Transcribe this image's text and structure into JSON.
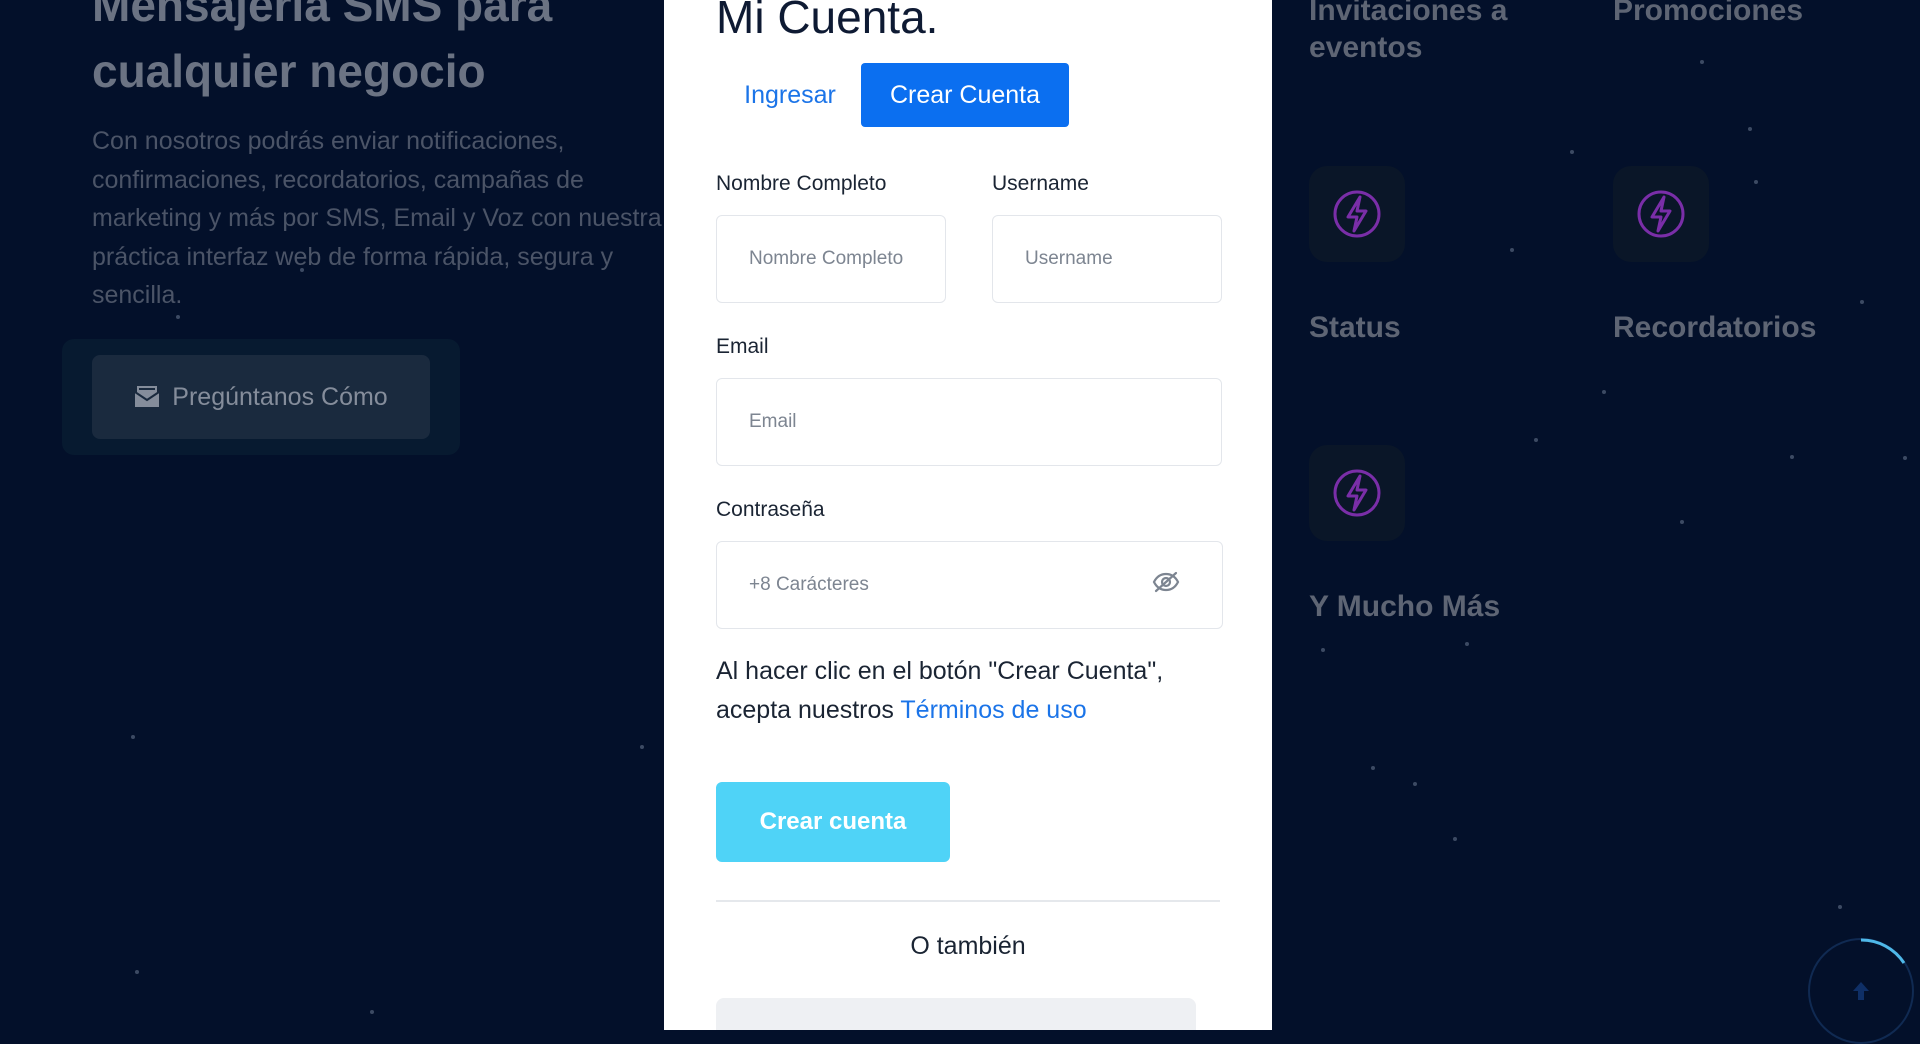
{
  "background": {
    "hero_title": "Mensajería SMS para cualquier negocio",
    "hero_text": "Con nosotros podrás enviar notificaciones, confirmaciones, recordatorios, campañas de marketing y más por SMS, Email y Voz con nuestra práctica interfaz web de forma rápida, segura y sencilla.",
    "cta_label": "Pregúntanos Cómo",
    "features": [
      {
        "title": "Invitaciones a eventos"
      },
      {
        "title": "Promociones"
      },
      {
        "title": "Status"
      },
      {
        "title": "Recordatorios"
      },
      {
        "title": "Y Mucho Más"
      }
    ]
  },
  "modal": {
    "title": "Mi Cuenta.",
    "tabs": [
      {
        "label": "Ingresar",
        "active": false
      },
      {
        "label": "Crear Cuenta",
        "active": true
      }
    ],
    "fields": {
      "full_name": {
        "label": "Nombre Completo",
        "placeholder": "Nombre Completo",
        "value": ""
      },
      "username": {
        "label": "Username",
        "placeholder": "Username",
        "value": ""
      },
      "email": {
        "label": "Email",
        "placeholder": "Email",
        "value": ""
      },
      "password": {
        "label": "Contraseña",
        "placeholder": "+8 Carácteres",
        "value": ""
      }
    },
    "terms_text": "Al hacer clic en el botón \"Crear Cuenta\", acepta nuestros",
    "terms_link": "Términos de uso",
    "submit_label": "Crear cuenta",
    "or_text": "O también"
  },
  "colors": {
    "page_bg": "#03102a",
    "accent": "#0b6ff0",
    "submit": "#4fd3f7",
    "link": "#1b74e8",
    "feature_icon": "#7a2ea8"
  },
  "icons": {
    "cta": "envelope-icon",
    "feature": "lightning-bolt-icon",
    "password_toggle": "eye-slash-icon",
    "scroll_top": "arrow-up-icon"
  }
}
